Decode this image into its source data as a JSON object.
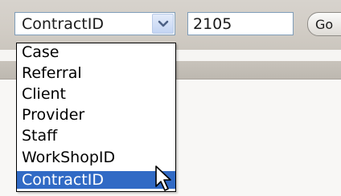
{
  "select": {
    "value": "ContractID",
    "icon": "chevron-down-icon",
    "options": [
      "Case",
      "Referral",
      "Client",
      "Provider",
      "Staff",
      "WorkShopID",
      "ContractID"
    ],
    "selected_option": "ContractID"
  },
  "search_input": {
    "value": "2105"
  },
  "go_button": {
    "label": "Go"
  },
  "colors": {
    "selection": "#316ac5",
    "field_border": "#7f9db9"
  }
}
